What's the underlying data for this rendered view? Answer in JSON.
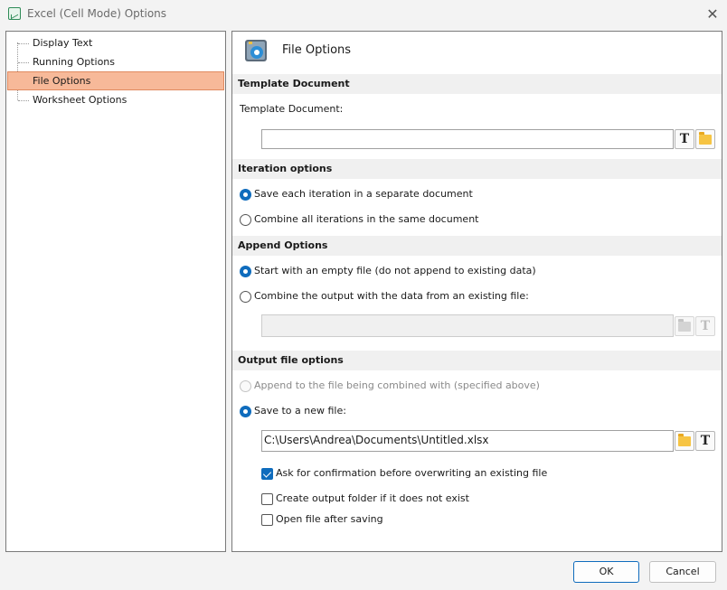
{
  "window": {
    "title": "Excel (Cell Mode) Options",
    "close_glyph": "✕"
  },
  "tree": {
    "items": [
      {
        "label": "Display Text"
      },
      {
        "label": "Running Options"
      },
      {
        "label": "File Options",
        "selected": true
      },
      {
        "label": "Worksheet Options"
      }
    ]
  },
  "panel": {
    "title": "File Options",
    "icon": "gear-settings-icon"
  },
  "template_section": {
    "header": "Template Document",
    "field_label": "Template Document:",
    "value": ""
  },
  "iteration_section": {
    "header": "Iteration options",
    "opt_separate": "Save each iteration in a separate document",
    "opt_combine": "Combine all iterations in the same document",
    "selected": "separate"
  },
  "append_section": {
    "header": "Append Options",
    "opt_empty": "Start with an empty file (do not append to existing data)",
    "opt_combine": "Combine the output with the data from an existing file:",
    "existing_file_value": "",
    "selected": "empty"
  },
  "output_section": {
    "header": "Output file options",
    "opt_append": "Append to the file being combined with (specified above)",
    "opt_new": "Save to a new file:",
    "new_file_path": "C:\\Users\\Andrea\\Documents\\Untitled.xlsx",
    "selected": "new",
    "chk_confirm": "Ask for confirmation before overwriting an existing file",
    "chk_confirm_checked": true,
    "chk_create_folder": "Create output folder if it does not exist",
    "chk_create_folder_checked": false,
    "chk_open": "Open file after saving",
    "chk_open_checked": false
  },
  "buttons": {
    "ok": "OK",
    "cancel": "Cancel",
    "text_glyph": "T"
  },
  "colors": {
    "accent": "#0f6cbd",
    "selection": "#f7b999",
    "folder": "#f6c443"
  }
}
